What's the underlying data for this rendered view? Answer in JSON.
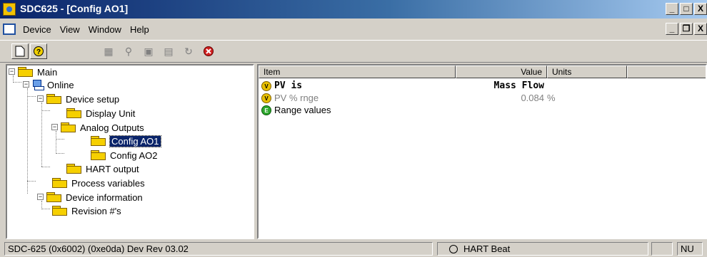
{
  "window": {
    "title": "SDC625 - [Config AO1]",
    "min": "_",
    "max": "□",
    "close": "X"
  },
  "menubar": {
    "items": [
      "Device",
      "View",
      "Window",
      "Help"
    ],
    "mdi_min": "_",
    "mdi_restore": "❐",
    "mdi_close": "X"
  },
  "tree": {
    "items": [
      {
        "label": "Main"
      },
      {
        "label": "Online"
      },
      {
        "label": "Device setup"
      },
      {
        "label": "Display Unit"
      },
      {
        "label": "Analog Outputs"
      },
      {
        "label": "Config AO1"
      },
      {
        "label": "Config AO2"
      },
      {
        "label": "HART output"
      },
      {
        "label": "Process variables"
      },
      {
        "label": "Device information"
      },
      {
        "label": "Revision #'s"
      }
    ]
  },
  "list": {
    "columns": {
      "item": "Item",
      "value": "Value",
      "units": "Units"
    },
    "rows": [
      {
        "item": "PV is",
        "value": "Mass Flow",
        "units": ""
      },
      {
        "item": "PV % rnge",
        "value": "0.084",
        "units": "%"
      },
      {
        "item": "Range values",
        "value": "",
        "units": ""
      }
    ]
  },
  "status": {
    "device": "SDC-625  (0x6002)  (0xe0da) Dev Rev 03.02",
    "hart": "HART Beat",
    "num": "NU"
  },
  "colors": {
    "title_start": "#0a246a",
    "title_end": "#a6caf0",
    "selection": "#0a246a"
  }
}
